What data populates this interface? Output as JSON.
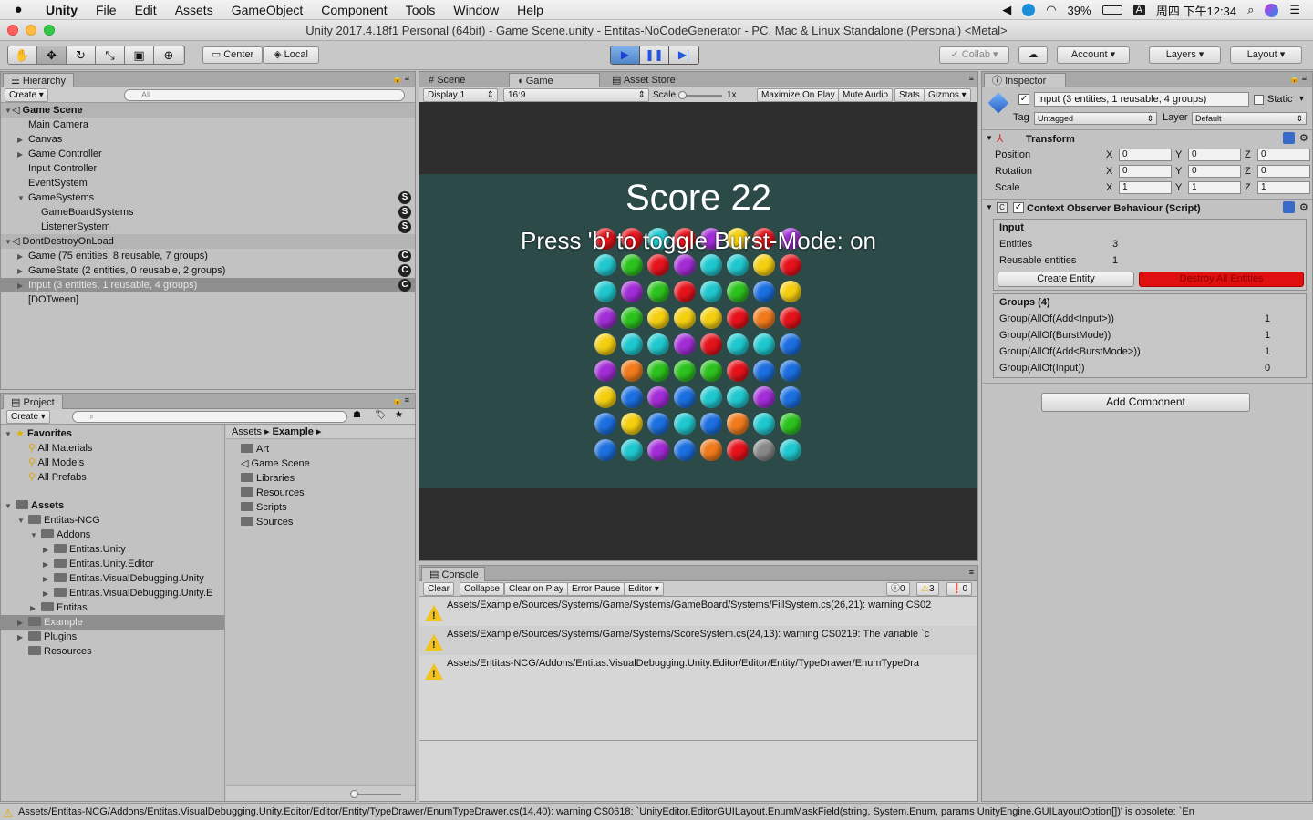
{
  "menubar": {
    "app_name": "Unity",
    "items": [
      "File",
      "Edit",
      "Assets",
      "GameObject",
      "Component",
      "Tools",
      "Window",
      "Help"
    ],
    "battery": "39%",
    "clock": "周四 下午12:34",
    "input_method": "A"
  },
  "window": {
    "title": "Unity 2017.4.18f1 Personal (64bit) - Game Scene.unity - Entitas-NoCodeGenerator - PC, Mac & Linux Standalone (Personal) <Metal>"
  },
  "toolbar": {
    "center_label": "Center",
    "local_label": "Local",
    "collab_label": "Collab",
    "account_label": "Account",
    "layers_label": "Layers",
    "layout_label": "Layout"
  },
  "hierarchy": {
    "tab_label": "Hierarchy",
    "create_label": "Create",
    "search_placeholder": "All",
    "scenes": [
      {
        "name": "Game Scene"
      },
      {
        "name": "DontDestroyOnLoad"
      }
    ],
    "items": [
      {
        "label": "Main Camera"
      },
      {
        "label": "Canvas"
      },
      {
        "label": "Game Controller"
      },
      {
        "label": "Input Controller"
      },
      {
        "label": "EventSystem"
      },
      {
        "label": "GameSystems",
        "badge": "S"
      },
      {
        "label": "GameBoardSystems",
        "badge": "S"
      },
      {
        "label": "ListenerSystem",
        "badge": "S"
      },
      {
        "label": "Game (75 entities, 8 reusable, 7 groups)",
        "badge": "C"
      },
      {
        "label": "GameState (2 entities, 0 reusable, 2 groups)",
        "badge": "C"
      },
      {
        "label": "Input (3 entities, 1 reusable, 4 groups)",
        "badge": "C"
      },
      {
        "label": "[DOTween]"
      }
    ]
  },
  "project": {
    "tab_label": "Project",
    "create_label": "Create",
    "favorites_label": "Favorites",
    "favorites": [
      "All Materials",
      "All Models",
      "All Prefabs"
    ],
    "assets_label": "Assets",
    "tree": [
      "Entitas-NCG",
      "Addons",
      "Entitas.Unity",
      "Entitas.Unity.Editor",
      "Entitas.VisualDebugging.Unity",
      "Entitas.VisualDebugging.Unity.E",
      "Entitas",
      "Example",
      "Plugins",
      "Resources"
    ],
    "breadcrumb": [
      "Assets",
      "Example"
    ],
    "folders": [
      "Art",
      "Game Scene",
      "Libraries",
      "Resources",
      "Scripts",
      "Sources"
    ]
  },
  "sceneview": {
    "tabs": [
      "Scene",
      "Game",
      "Asset Store"
    ],
    "display": "Display 1",
    "aspect": "16:9",
    "scale_label": "Scale",
    "scale_value": "1x",
    "maximize": "Maximize On Play",
    "mute": "Mute Audio",
    "stats": "Stats",
    "gizmos": "Gizmos"
  },
  "game": {
    "score_text": "Score 22",
    "burst_text": "Press 'b' to toggle Burst-Mode: on",
    "colors": {
      "c": "#1fc8cf",
      "g": "#2cc21e",
      "r": "#e5121b",
      "p": "#a22cd6",
      "y": "#f4cf0f",
      "b": "#1b6fe0",
      "o": "#f07a1c",
      "bg": "#2b4a48"
    },
    "grid": [
      "cgrpccyr",
      "cpgrcgby",
      "pgyyyror",
      "yccprccb",
      "pogggrbb",
      "ybpbccpb",
      "bybcbocg",
      "bcpbordc"
    ],
    "top_row": "rrcrpyrp"
  },
  "inspector": {
    "tab_label": "Inspector",
    "object_name": "Input (3 entities, 1 reusable, 4 groups)",
    "static_label": "Static",
    "tag_label": "Tag",
    "tag_value": "Untagged",
    "layer_label": "Layer",
    "layer_value": "Default",
    "transform_label": "Transform",
    "position_label": "Position",
    "rotation_label": "Rotation",
    "scale_label": "Scale",
    "pos": [
      "0",
      "0",
      "0"
    ],
    "rot": [
      "0",
      "0",
      "0"
    ],
    "scl": [
      "1",
      "1",
      "1"
    ],
    "axis": [
      "X",
      "Y",
      "Z"
    ],
    "component_label": "Context Observer Behaviour (Script)",
    "input_header": "Input",
    "entities_label": "Entities",
    "entities_value": "3",
    "reusable_label": "Reusable entities",
    "reusable_value": "1",
    "create_entity": "Create Entity",
    "destroy_all": "Destroy All Entities",
    "groups_header": "Groups (4)",
    "groups": [
      {
        "name": "Group(AllOf(Add<Input>))",
        "count": "1"
      },
      {
        "name": "Group(AllOf(BurstMode))",
        "count": "1"
      },
      {
        "name": "Group(AllOf(Add<BurstMode>))",
        "count": "1"
      },
      {
        "name": "Group(AllOf(Input))",
        "count": "0"
      }
    ],
    "add_component": "Add Component"
  },
  "console": {
    "tab_label": "Console",
    "buttons": [
      "Clear",
      "Collapse",
      "Clear on Play",
      "Error Pause",
      "Editor"
    ],
    "info_count": "0",
    "warn_count": "3",
    "error_count": "0",
    "messages": [
      "Assets/Example/Sources/Systems/Game/Systems/GameBoard/Systems/FillSystem.cs(26,21): warning CS02",
      "Assets/Example/Sources/Systems/Game/Systems/ScoreSystem.cs(24,13): warning CS0219: The variable `c",
      "Assets/Entitas-NCG/Addons/Entitas.VisualDebugging.Unity.Editor/Editor/Entity/TypeDrawer/EnumTypeDra"
    ]
  },
  "statusbar": {
    "text": "Assets/Entitas-NCG/Addons/Entitas.VisualDebugging.Unity.Editor/Editor/Entity/TypeDrawer/EnumTypeDrawer.cs(14,40): warning CS0618: `UnityEditor.EditorGUILayout.EnumMaskField(string, System.Enum, params UnityEngine.GUILayoutOption[])' is obsolete: `En"
  }
}
